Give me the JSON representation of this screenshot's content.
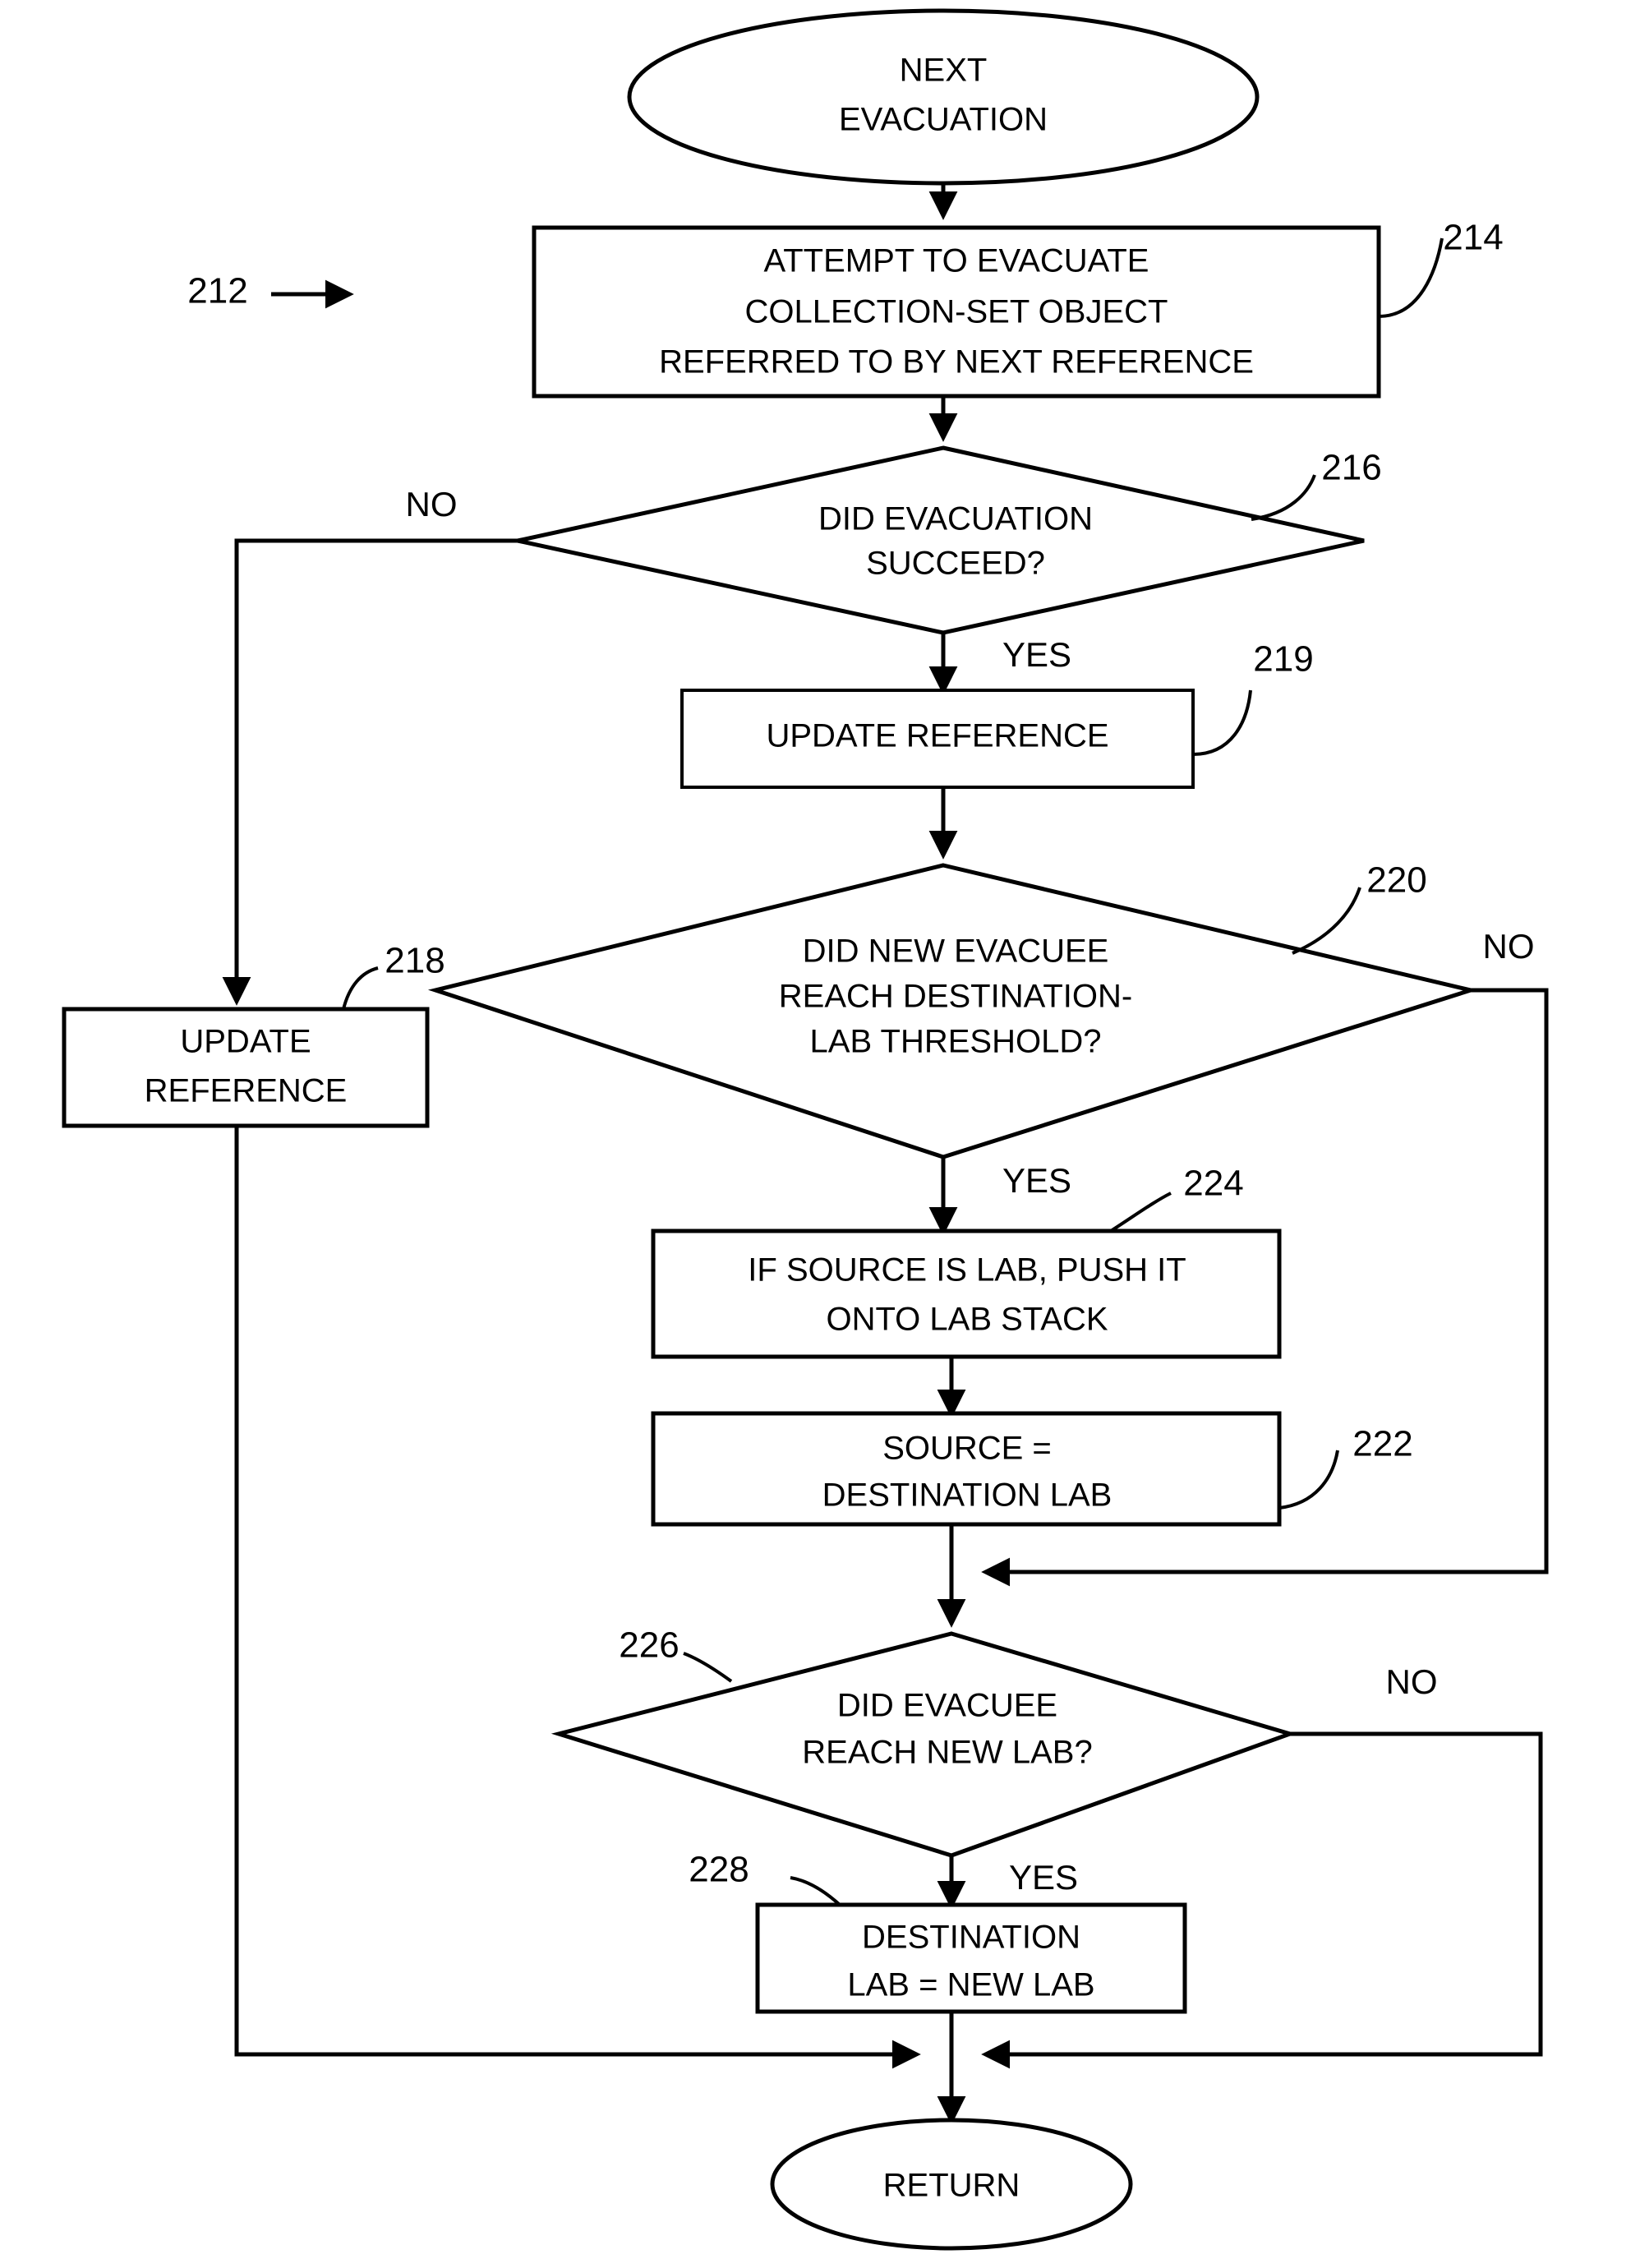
{
  "diagram": {
    "title_ref": "212",
    "nodes": {
      "start": {
        "label_line1": "NEXT",
        "label_line2": "EVACUATION"
      },
      "attempt": {
        "ref": "214",
        "line1": "ATTEMPT TO EVACUATE",
        "line2": "COLLECTION-SET OBJECT",
        "line3": "REFERRED TO BY NEXT REFERENCE"
      },
      "did_evac_succeed": {
        "ref": "216",
        "line1": "DID EVACUATION",
        "line2": "SUCCEED?",
        "yes_label": "YES",
        "no_label": "NO"
      },
      "update_reference_219": {
        "ref": "219",
        "line1": "UPDATE REFERENCE"
      },
      "update_reference_218": {
        "ref": "218",
        "line1": "UPDATE",
        "line2": "REFERENCE"
      },
      "did_reach_threshold": {
        "ref": "220",
        "line1": "DID NEW EVACUEE",
        "line2": "REACH DESTINATION-",
        "line3": "LAB THRESHOLD?",
        "yes_label": "YES",
        "no_label": "NO"
      },
      "push_lab_stack": {
        "ref": "224",
        "line1": "IF SOURCE IS LAB, PUSH IT",
        "line2": "ONTO LAB STACK"
      },
      "source_dest_lab": {
        "ref": "222",
        "line1": "SOURCE =",
        "line2": "DESTINATION LAB"
      },
      "did_reach_new_lab": {
        "ref": "226",
        "line1": "DID EVACUEE",
        "line2": "REACH NEW LAB?",
        "yes_label": "YES",
        "no_label": "NO"
      },
      "dest_lab_new_lab": {
        "ref": "228",
        "line1": "DESTINATION",
        "line2": "LAB = NEW LAB"
      },
      "end": {
        "label": "RETURN"
      }
    },
    "colors": {
      "stroke": "#000000",
      "fill": "#ffffff",
      "text": "#000000"
    }
  }
}
